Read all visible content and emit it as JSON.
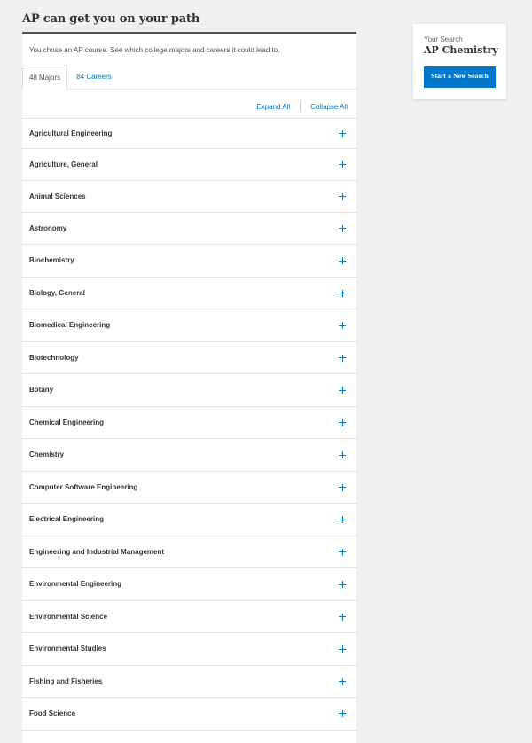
{
  "page": {
    "title": "AP can get you on your path"
  },
  "intro": "You chose an AP course. See which college majors and careers it could lead to.",
  "tabs": [
    {
      "label": "48 Majors",
      "active": true
    },
    {
      "label": "84 Careers",
      "active": false
    }
  ],
  "controls": {
    "expand_all": "Expand All",
    "collapse_all": "Collapse All"
  },
  "majors": [
    "Agricultural Engineering",
    "Agriculture, General",
    "Animal Sciences",
    "Astronomy",
    "Biochemistry",
    "Biology, General",
    "Biomedical Engineering",
    "Biotechnology",
    "Botany",
    "Chemical Engineering",
    "Chemistry",
    "Computer Software Engineering",
    "Electrical Engineering",
    "Engineering and Industrial Management",
    "Environmental Engineering",
    "Environmental Science",
    "Environmental Studies",
    "Fishing and Fisheries",
    "Food Science"
  ],
  "expand_icon": "plus-icon",
  "sidebar": {
    "label": "Your Search",
    "course": "AP Chemistry",
    "button_label": "Start a New Search"
  },
  "colors": {
    "accent": "#0077c8",
    "background": "#f0f0f0",
    "panel": "#ffffff",
    "title_rule": "#555555"
  }
}
